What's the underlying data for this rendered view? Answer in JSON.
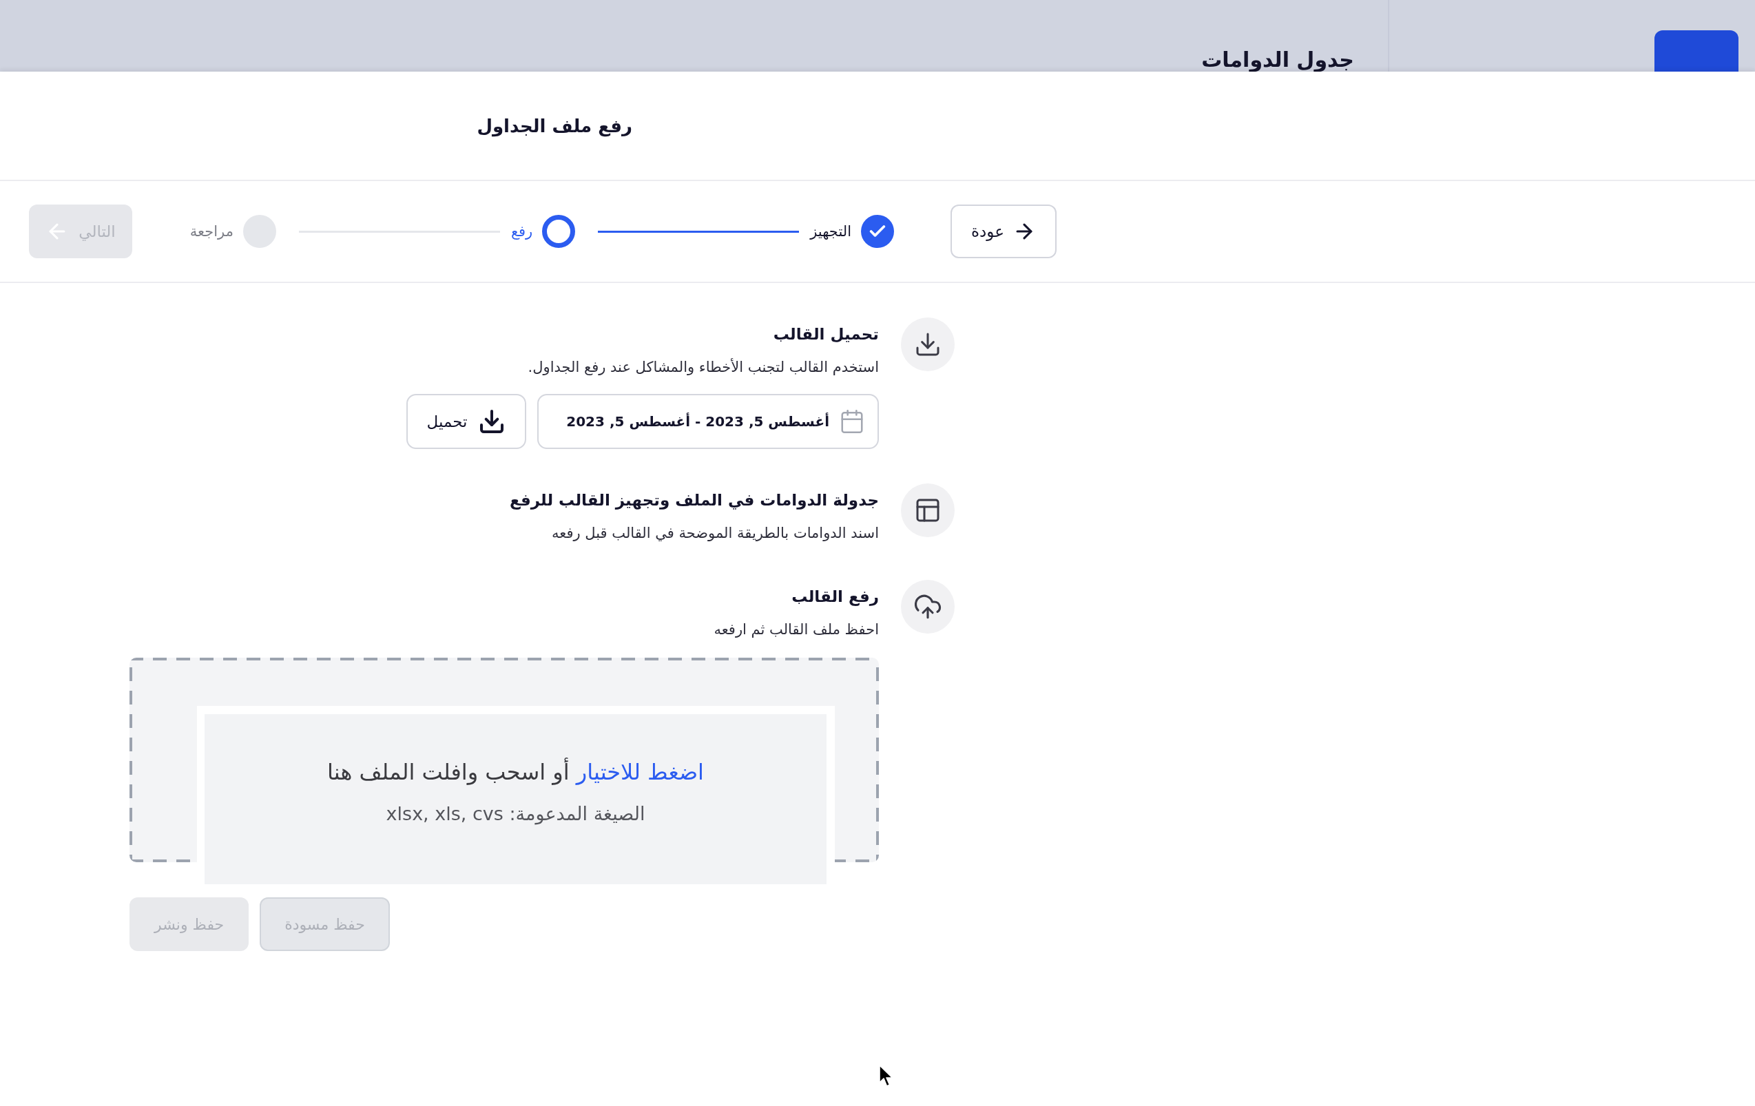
{
  "backdrop": {
    "title": "جدول الدوامات"
  },
  "dialog": {
    "title": "رفع ملف الجداول"
  },
  "stepper": {
    "back_button": "عودة",
    "steps": [
      {
        "label": "التجهيز",
        "completed": true,
        "selected": false
      },
      {
        "label": "رفع",
        "completed": false,
        "selected": true
      },
      {
        "label": "مراجعة",
        "completed": false,
        "selected": false
      }
    ],
    "next_button": {
      "label": "التالي",
      "disabled": true
    }
  },
  "sections": [
    {
      "kind": "download",
      "title": "تحميل القالب",
      "description": "استخدم القالب لتجنب الأخطاء والمشاكل عند رفع الجداول.",
      "date_range": "أغسطس 5, 2023 - أغسطس 5, 2023",
      "download_button": "تحميل"
    },
    {
      "kind": "layout",
      "title": "جدولة الدوامات في الملف وتجهيز القالب للرفع",
      "description": "اسند الدوامات بالطريقة الموضحة في القالب قبل رفعه"
    },
    {
      "kind": "upload",
      "title": "رفع القالب",
      "description": "احفظ ملف القالب ثم ارفعه",
      "dropzone": {
        "link": "اضغط للاختيار",
        "text": "أو اسحب وافلت الملف هنا",
        "formats": "الصيغة المدعومة: xlsx, xls, cvs"
      }
    }
  ],
  "actions": [
    {
      "label": "حفظ مسودة",
      "kind": "outline",
      "disabled": true
    },
    {
      "label": "حفظ ونشر",
      "kind": "filled",
      "disabled": true
    }
  ]
}
